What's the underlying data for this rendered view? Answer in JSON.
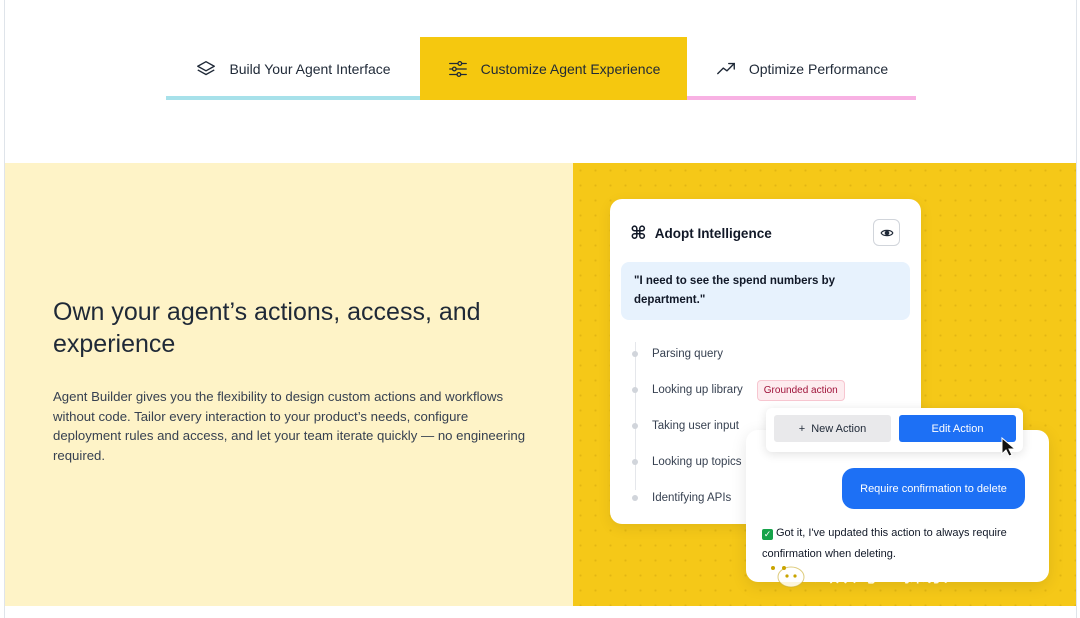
{
  "tabs": [
    {
      "label": "Build Your Agent Interface",
      "icon": "layers-icon",
      "accent": "#a7e1ea"
    },
    {
      "label": "Customize Agent Experience",
      "icon": "sliders-icon",
      "accent": "#f5c80f"
    },
    {
      "label": "Optimize Performance",
      "icon": "trending-up-icon",
      "accent": "#f8b1e3"
    }
  ],
  "hero": {
    "headline": "Own your agent’s actions, access, and experience",
    "body": "Agent Builder gives you the flexibility to design custom actions and workflows without code. Tailor every interaction to your product’s needs, configure deployment rules and access, and let your team iterate quickly — no engineering required."
  },
  "card": {
    "title": "Adopt Intelligence",
    "title_icon": "⌘",
    "quote": "\"I need to see the spend numbers by department.\"",
    "steps": [
      {
        "label": "Parsing query"
      },
      {
        "label": "Looking up library",
        "badge": "Grounded action"
      },
      {
        "label": "Taking user input"
      },
      {
        "label": "Looking up topics"
      },
      {
        "label": "Identifying APIs"
      }
    ]
  },
  "actions": {
    "new_label": "New Action",
    "edit_label": "Edit Action"
  },
  "chat": {
    "user_message": "Require confirmation to delete",
    "reply": "Got it, I've updated this action to always require confirmation when deleting."
  },
  "watermark": {
    "text": "公众号 · 探索AGI"
  },
  "colors": {
    "band_left": "#fef3c7",
    "band_right": "#f5c818",
    "primary_blue": "#1d70f5"
  }
}
